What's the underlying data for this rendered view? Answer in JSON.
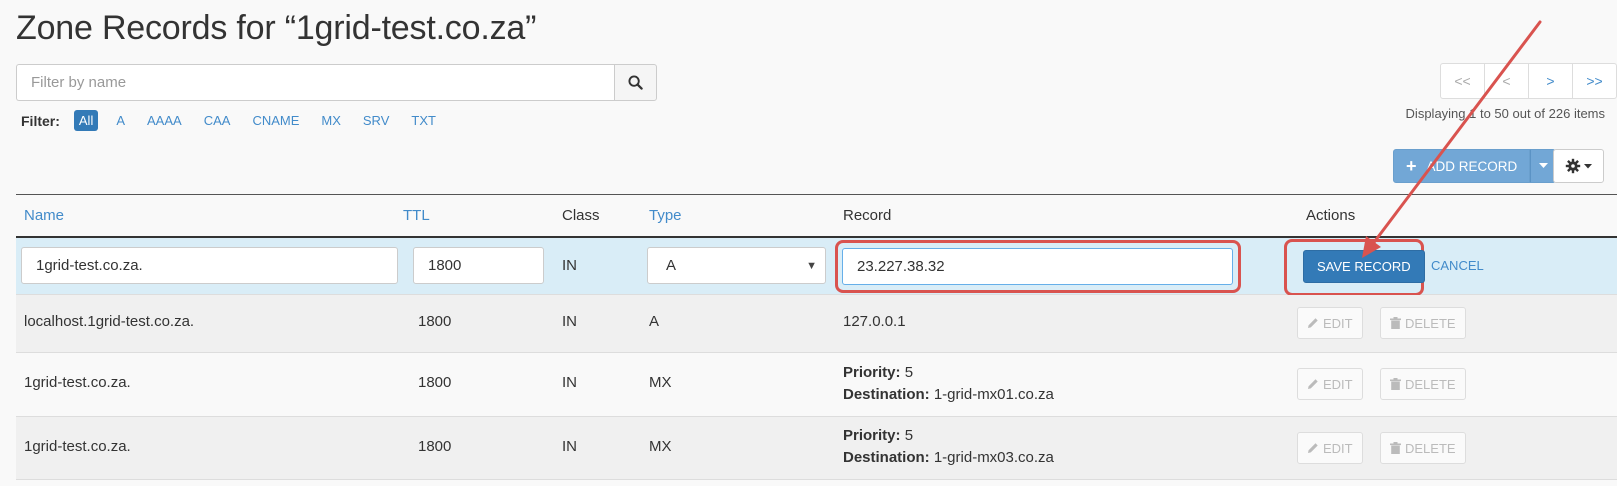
{
  "page": {
    "title": "Zone Records for “1grid-test.co.za”"
  },
  "search": {
    "placeholder": "Filter by name",
    "icon": "search-icon"
  },
  "filter": {
    "label": "Filter:",
    "options": [
      "All",
      "A",
      "AAAA",
      "CAA",
      "CNAME",
      "MX",
      "SRV",
      "TXT"
    ],
    "active": "All"
  },
  "pagination": {
    "first": "<<",
    "prev": "<",
    "next": ">",
    "last": ">>",
    "summary": "Displaying 1 to 50 out of 226 items"
  },
  "toolbar": {
    "add_record_label": "ADD RECORD",
    "add_icon": "plus-icon",
    "dropdown_icon": "caret-down-icon",
    "settings_icon": "gear-icon"
  },
  "table": {
    "columns": {
      "name": "Name",
      "ttl": "TTL",
      "class": "Class",
      "type": "Type",
      "record": "Record",
      "actions": "Actions"
    },
    "edit_row": {
      "name": "1grid-test.co.za.",
      "ttl": "1800",
      "class": "IN",
      "type": "A",
      "record": "23.227.38.32",
      "save_label": "SAVE RECORD",
      "cancel_label": "CANCEL"
    },
    "rows": [
      {
        "name": "localhost.1grid-test.co.za.",
        "ttl": "1800",
        "class": "IN",
        "type": "A",
        "record": "127.0.0.1"
      },
      {
        "name": "1grid-test.co.za.",
        "ttl": "1800",
        "class": "IN",
        "type": "MX",
        "priority_label": "Priority:",
        "priority": "5",
        "destination_label": "Destination:",
        "destination": "1-grid-mx01.co.za"
      },
      {
        "name": "1grid-test.co.za.",
        "ttl": "1800",
        "class": "IN",
        "type": "MX",
        "priority_label": "Priority:",
        "priority": "5",
        "destination_label": "Destination:",
        "destination": "1-grid-mx03.co.za"
      }
    ],
    "edit_label": "EDIT",
    "delete_label": "DELETE",
    "edit_icon": "pencil-icon",
    "delete_icon": "trash-icon"
  },
  "annotation": {
    "color": "#d9534f"
  },
  "colors": {
    "link": "#428bca",
    "primary": "#337ab7",
    "edit_row_bg": "#d9edf7"
  }
}
